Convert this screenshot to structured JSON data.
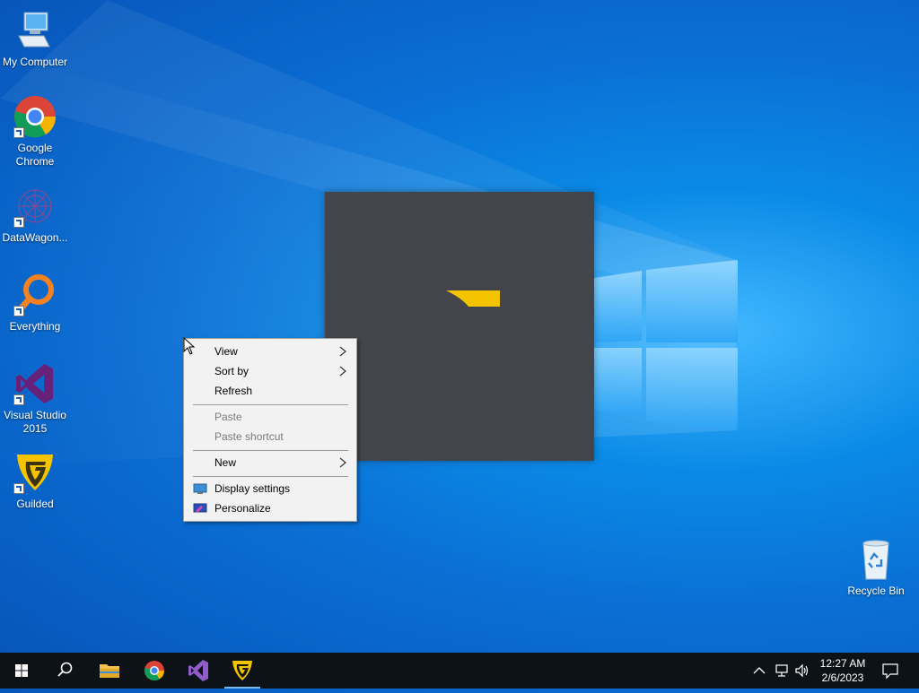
{
  "desktop": {
    "icons": [
      {
        "label": "My Computer",
        "icon": "computer-icon"
      },
      {
        "label": "Google Chrome",
        "icon": "chrome-icon"
      },
      {
        "label": "DataWagon...",
        "icon": "datawagon-icon"
      },
      {
        "label": "Everything",
        "icon": "everything-search-icon"
      },
      {
        "label": "Visual Studio 2015",
        "icon": "visual-studio-icon"
      },
      {
        "label": "Guilded",
        "icon": "guilded-icon"
      }
    ],
    "recycle_bin": {
      "label": "Recycle Bin",
      "icon": "recycle-bin-icon"
    }
  },
  "context_menu": {
    "items": [
      {
        "label": "View",
        "enabled": true,
        "submenu": true
      },
      {
        "label": "Sort by",
        "enabled": true,
        "submenu": true
      },
      {
        "label": "Refresh",
        "enabled": true,
        "submenu": false
      },
      {
        "label": "Paste",
        "enabled": false,
        "submenu": false
      },
      {
        "label": "Paste shortcut",
        "enabled": false,
        "submenu": false
      },
      {
        "label": "New",
        "enabled": true,
        "submenu": true
      },
      {
        "label": "Display settings",
        "enabled": true,
        "submenu": false,
        "icon": "display-icon"
      },
      {
        "label": "Personalize",
        "enabled": true,
        "submenu": false,
        "icon": "personalize-icon"
      }
    ]
  },
  "taskbar": {
    "pinned": [
      {
        "name": "start",
        "icon": "windows-icon"
      },
      {
        "name": "search",
        "icon": "search-icon"
      },
      {
        "name": "file-explorer",
        "icon": "folder-icon"
      },
      {
        "name": "chrome",
        "icon": "chrome-icon"
      },
      {
        "name": "visual-studio",
        "icon": "visual-studio-icon"
      },
      {
        "name": "guilded",
        "icon": "guilded-icon",
        "active": true
      }
    ],
    "clock": {
      "time": "12:27 AM",
      "date": "2/6/2023"
    }
  },
  "colors": {
    "desktop_accent": "#0a78d8",
    "taskbar": "#0d1217",
    "splash": "#44454b",
    "guilded_gold": "#f5c400",
    "vs_purple": "#68217a"
  }
}
